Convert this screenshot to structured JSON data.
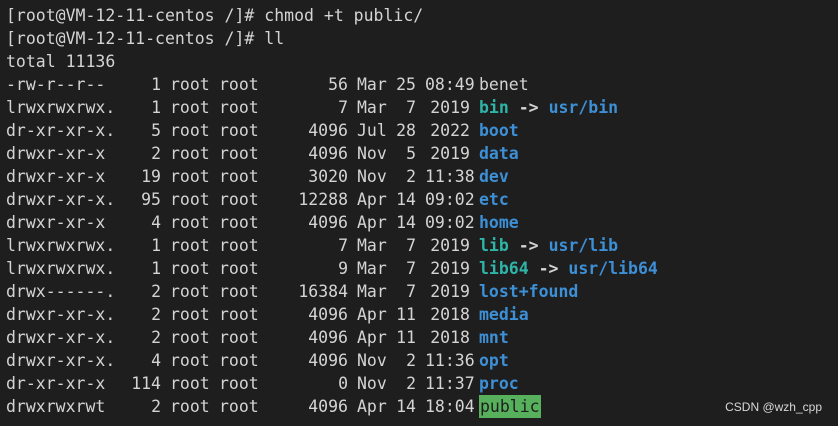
{
  "commands": [
    "[root@VM-12-11-centos /]# chmod +t public/",
    "[root@VM-12-11-centos /]# ll"
  ],
  "total_line": "total 11136",
  "entries": [
    {
      "perm": "-rw-r--r--",
      "links": "1",
      "owner": "root",
      "group": "root",
      "size": "56",
      "month": "Mar",
      "day": "25",
      "time": "08:49",
      "name": "benet",
      "type": "file",
      "target": ""
    },
    {
      "perm": "lrwxrwxrwx.",
      "links": "1",
      "owner": "root",
      "group": "root",
      "size": "7",
      "month": "Mar",
      "day": "7",
      "time": "2019",
      "name": "bin",
      "type": "link",
      "target": "usr/bin"
    },
    {
      "perm": "dr-xr-xr-x.",
      "links": "5",
      "owner": "root",
      "group": "root",
      "size": "4096",
      "month": "Jul",
      "day": "28",
      "time": "2022",
      "name": "boot",
      "type": "dir",
      "target": ""
    },
    {
      "perm": "drwxr-xr-x",
      "links": "2",
      "owner": "root",
      "group": "root",
      "size": "4096",
      "month": "Nov",
      "day": "5",
      "time": "2019",
      "name": "data",
      "type": "dir",
      "target": ""
    },
    {
      "perm": "drwxr-xr-x",
      "links": "19",
      "owner": "root",
      "group": "root",
      "size": "3020",
      "month": "Nov",
      "day": "2",
      "time": "11:38",
      "name": "dev",
      "type": "dir",
      "target": ""
    },
    {
      "perm": "drwxr-xr-x.",
      "links": "95",
      "owner": "root",
      "group": "root",
      "size": "12288",
      "month": "Apr",
      "day": "14",
      "time": "09:02",
      "name": "etc",
      "type": "dir",
      "target": ""
    },
    {
      "perm": "drwxr-xr-x",
      "links": "4",
      "owner": "root",
      "group": "root",
      "size": "4096",
      "month": "Apr",
      "day": "14",
      "time": "09:02",
      "name": "home",
      "type": "dir",
      "target": ""
    },
    {
      "perm": "lrwxrwxrwx.",
      "links": "1",
      "owner": "root",
      "group": "root",
      "size": "7",
      "month": "Mar",
      "day": "7",
      "time": "2019",
      "name": "lib",
      "type": "link",
      "target": "usr/lib"
    },
    {
      "perm": "lrwxrwxrwx.",
      "links": "1",
      "owner": "root",
      "group": "root",
      "size": "9",
      "month": "Mar",
      "day": "7",
      "time": "2019",
      "name": "lib64",
      "type": "link",
      "target": "usr/lib64"
    },
    {
      "perm": "drwx------.",
      "links": "2",
      "owner": "root",
      "group": "root",
      "size": "16384",
      "month": "Mar",
      "day": "7",
      "time": "2019",
      "name": "lost+found",
      "type": "dir",
      "target": ""
    },
    {
      "perm": "drwxr-xr-x.",
      "links": "2",
      "owner": "root",
      "group": "root",
      "size": "4096",
      "month": "Apr",
      "day": "11",
      "time": "2018",
      "name": "media",
      "type": "dir",
      "target": ""
    },
    {
      "perm": "drwxr-xr-x.",
      "links": "2",
      "owner": "root",
      "group": "root",
      "size": "4096",
      "month": "Apr",
      "day": "11",
      "time": "2018",
      "name": "mnt",
      "type": "dir",
      "target": ""
    },
    {
      "perm": "drwxr-xr-x.",
      "links": "4",
      "owner": "root",
      "group": "root",
      "size": "4096",
      "month": "Nov",
      "day": "2",
      "time": "11:36",
      "name": "opt",
      "type": "dir",
      "target": ""
    },
    {
      "perm": "dr-xr-xr-x",
      "links": "114",
      "owner": "root",
      "group": "root",
      "size": "0",
      "month": "Nov",
      "day": "2",
      "time": "11:37",
      "name": "proc",
      "type": "dir",
      "target": ""
    },
    {
      "perm": "drwxrwxrwt",
      "links": "2",
      "owner": "root",
      "group": "root",
      "size": "4096",
      "month": "Apr",
      "day": "14",
      "time": "18:04",
      "name": "public",
      "type": "sticky",
      "target": ""
    }
  ],
  "link_arrow": "->",
  "watermark": "CSDN @wzh_cpp",
  "colors": {
    "background": "#1e1e1e",
    "text": "#d4d4d4",
    "directory": "#3d8fd6",
    "symlink": "#2fb5a8",
    "sticky_bg": "#57b05c"
  }
}
